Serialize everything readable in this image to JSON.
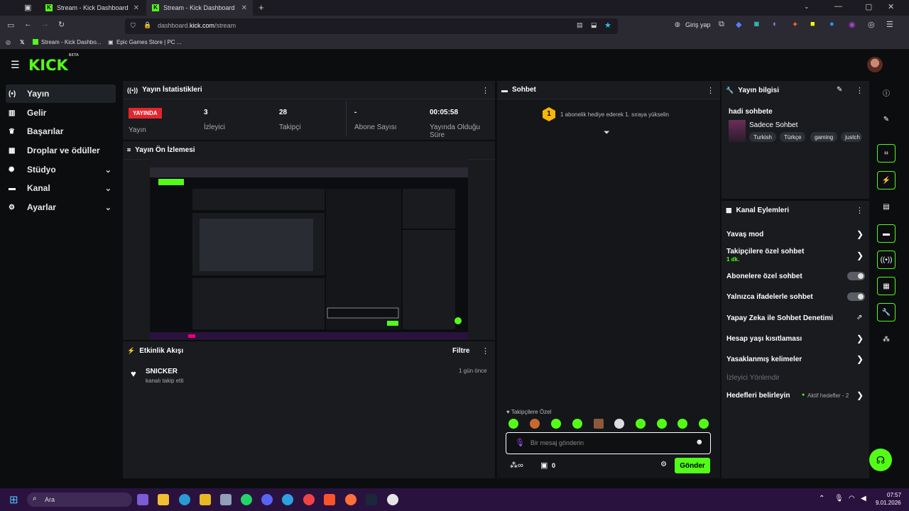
{
  "browser": {
    "tabs": [
      {
        "title": "Stream - Kick Dashboard"
      },
      {
        "title": "Stream - Kick Dashboard"
      }
    ],
    "url_prefix": "dashboard.",
    "url_domain": "kick.com",
    "url_path": "/stream",
    "signin_label": "Giriş yap",
    "bookmarks": [
      "Stream - Kick Dashbo...",
      "Epic Games Store | PC ..."
    ]
  },
  "kick": {
    "logo": "KICK",
    "logo_beta": "BETA"
  },
  "sidebar": {
    "items": [
      {
        "label": "Yayın",
        "icon": "broadcast-icon",
        "glyph": "(•)"
      },
      {
        "label": "Gelir",
        "icon": "revenue-icon",
        "glyph": "▥"
      },
      {
        "label": "Başarılar",
        "icon": "trophy-icon",
        "glyph": "🏆"
      },
      {
        "label": "Droplar ve ödüller",
        "icon": "gift-icon",
        "glyph": "▦"
      },
      {
        "label": "Stüdyo",
        "icon": "studio-icon",
        "glyph": "✺"
      },
      {
        "label": "Kanal",
        "icon": "channel-icon",
        "glyph": "▬"
      },
      {
        "label": "Ayarlar",
        "icon": "settings-icon",
        "glyph": "⚙"
      }
    ]
  },
  "stats": {
    "title": "Yayın İstatistikleri",
    "live_badge": "YAYINDA",
    "cols": [
      {
        "value": "",
        "label": "Yayın"
      },
      {
        "value": "3",
        "label": "İzleyici"
      },
      {
        "value": "28",
        "label": "Takipçi"
      },
      {
        "value": "-",
        "label": "Abone Sayısı"
      },
      {
        "value": "00:05:58",
        "label": "Yayında Olduğu Süre"
      }
    ]
  },
  "preview": {
    "title": "Yayın Ön İzlemesi"
  },
  "activity": {
    "title": "Etkinlik Akışı",
    "filter_label": "Filtre",
    "items": [
      {
        "user": "SNICKER",
        "text": "kanalı takip etti",
        "time": "1 gün önce"
      }
    ]
  },
  "chat": {
    "title": "Sohbet",
    "goal_number": "1",
    "goal_text": "1 abonelik hediye ederek 1. sıraya yükselin",
    "followers_only": "Takipçilere Özel",
    "input_placeholder": "Bir mesaj gönderin",
    "points": "0",
    "send_label": "Gönder"
  },
  "stream_info": {
    "title": "Yayın bilgisi",
    "stream_title": "hadi sohbete",
    "category": "Sadece Sohbet",
    "tags": [
      "Turkish",
      "Türkçe",
      "gaming",
      "justch"
    ]
  },
  "channel_actions": {
    "title": "Kanal Eylemleri",
    "slow_mode": "Yavaş mod",
    "followers_chat": "Takipçilere özel sohbet",
    "followers_chat_value": "1 dk.",
    "subs_chat": "Abonelere özel sohbet",
    "emote_chat": "Yalnızca ifadelerle sohbet",
    "ai_moderation": "Yapay Zeka ile Sohbet Denetimi",
    "account_age": "Hesap yaşı kısıtlaması",
    "banned_words": "Yasaklanmış kelimeler",
    "viewer_redirect": "İzleyici Yönlendir",
    "set_goals": "Hedefleri belirleyin",
    "active_goals": "Aktif hedefler - 2"
  },
  "taskbar": {
    "search_placeholder": "Ara",
    "time": "07:57",
    "date": "9.01.2026"
  },
  "colors": {
    "accent": "#53fc18",
    "live": "#e3262e",
    "panel": "#191b1f",
    "background": "#0b0d0f",
    "taskbar": "#2a123f"
  }
}
